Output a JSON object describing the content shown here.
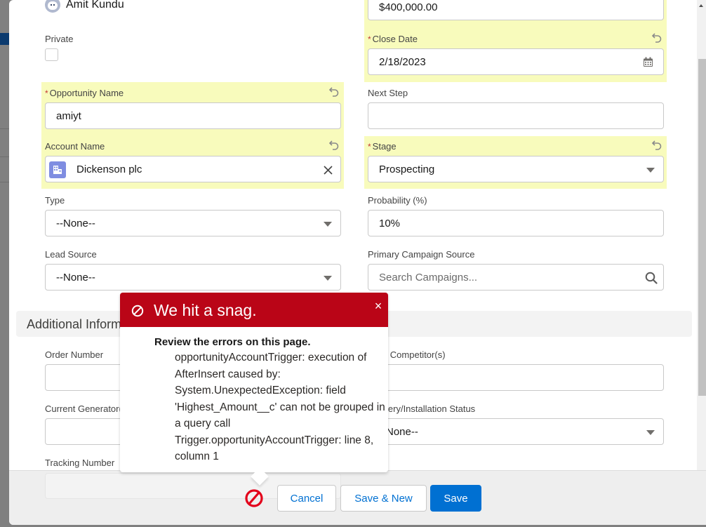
{
  "owner": {
    "name": "Amit Kundu"
  },
  "fields": {
    "amount": {
      "value": "$400,000.00"
    },
    "private": {
      "label": "Private",
      "checked": false
    },
    "close_date": {
      "label": "Close Date",
      "value": "2/18/2023",
      "required": "*"
    },
    "opportunity_name": {
      "label": "Opportunity Name",
      "value": "amiyt",
      "required": "*"
    },
    "next_step": {
      "label": "Next Step",
      "value": ""
    },
    "account_name": {
      "label": "Account Name",
      "value": "Dickenson plc"
    },
    "stage": {
      "label": "Stage",
      "value": "Prospecting",
      "required": "*"
    },
    "type": {
      "label": "Type",
      "value": "--None--"
    },
    "probability": {
      "label": "Probability (%)",
      "value": "10%"
    },
    "lead_source": {
      "label": "Lead Source",
      "value": "--None--"
    },
    "primary_campaign_source": {
      "label": "Primary Campaign Source",
      "placeholder": "Search Campaigns..."
    },
    "order_number": {
      "label": "Order Number",
      "value": ""
    },
    "main_competitors": {
      "label": "Main Competitor(s)",
      "value": ""
    },
    "current_generators": {
      "label": "Current Generator(s)",
      "value": ""
    },
    "delivery_status": {
      "label": "Delivery/Installation Status",
      "value": "--None--"
    },
    "tracking_number": {
      "label": "Tracking Number",
      "value": ""
    }
  },
  "section": {
    "title": "Additional Information"
  },
  "error_popover": {
    "title": "We hit a snag.",
    "heading": "Review the errors on this page.",
    "message": "opportunityAccountTrigger: execution of AfterInsert caused by: System.UnexpectedException: field 'Highest_Amount__c' can not be grouped in a query call Trigger.opportunityAccountTrigger: line 8, column 1",
    "close_glyph": "×"
  },
  "footer": {
    "cancel": "Cancel",
    "save_new": "Save & New",
    "save": "Save"
  },
  "colors": {
    "highlight": "#f8fbbc",
    "error": "#ba0517",
    "brand": "#0070d2"
  }
}
